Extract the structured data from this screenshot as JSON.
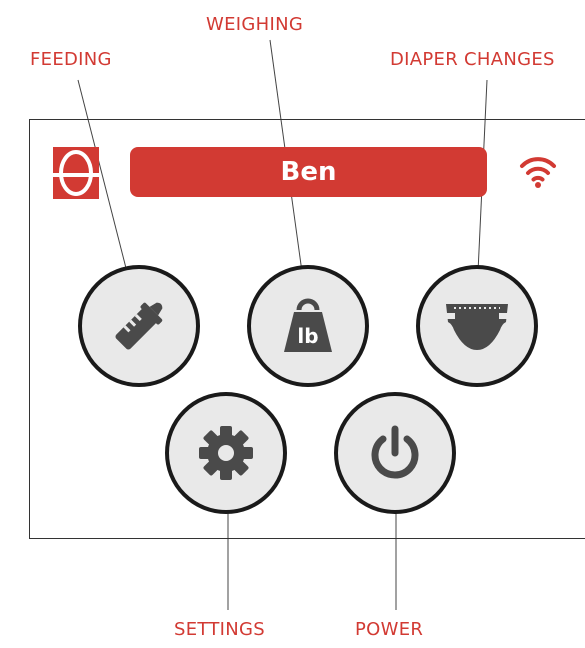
{
  "callouts": {
    "feeding": "FEEDING",
    "weighing": "WEIGHING",
    "diaper_changes": "DIAPER CHANGES",
    "settings": "SETTINGS",
    "power": "POWER"
  },
  "header": {
    "baby_name": "Ben"
  },
  "weigh_unit": "lb",
  "icons": {
    "logo": "brand-logo",
    "status": "wifi-icon",
    "feeding": "baby-bottle-icon",
    "weighing": "weight-icon",
    "diaper": "diaper-icon",
    "settings": "gear-icon",
    "power": "power-icon"
  },
  "colors": {
    "accent": "#d23a33",
    "icon": "#4a4a4a",
    "button_fill": "#e9e9e9",
    "button_ring": "#1a1a1a"
  }
}
